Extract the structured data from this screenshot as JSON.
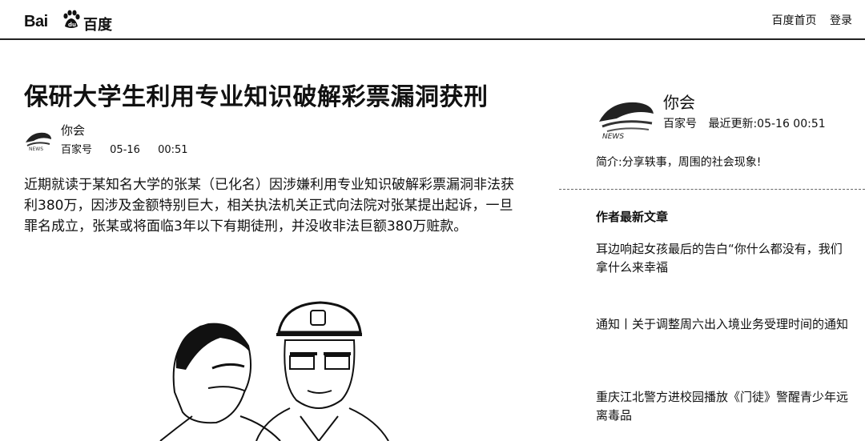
{
  "header": {
    "logo_text_left": "Bai",
    "logo_text_right": "百度",
    "nav": [
      "百度首页",
      "登录"
    ]
  },
  "article": {
    "title": "保研大学生利用专业知识破解彩票漏洞获刑",
    "author": "你会",
    "source": "百家号",
    "date": "05-16",
    "time": "00:51",
    "paragraph": "近期就读于某知名大学的张某（已化名）因涉嫌利用专业知识破解彩票漏洞非法获利380万，因涉及金额特别巨大，相关执法机关正式向法院对张某提出起诉，一旦罪名成立，张某或将面临3年以下有期徒刑，并没收非法巨额380万赃款。"
  },
  "sidebar": {
    "author": "你会",
    "source": "百家号",
    "updated_label": "最近更新:05-16 00:51",
    "intro": "简介:分享轶事，周围的社会现象!",
    "latest_heading": "作者最新文章",
    "articles": [
      "耳边响起女孩最后的告白“你什么都没有，我们拿什么来幸福",
      "通知丨关于调整周六出入境业务受理时间的通知",
      "重庆江北警方进校园播放《门徒》警醒青少年远离毒品"
    ]
  },
  "icons": [
    "baidu-paw-icon",
    "author-avatar-icon"
  ]
}
